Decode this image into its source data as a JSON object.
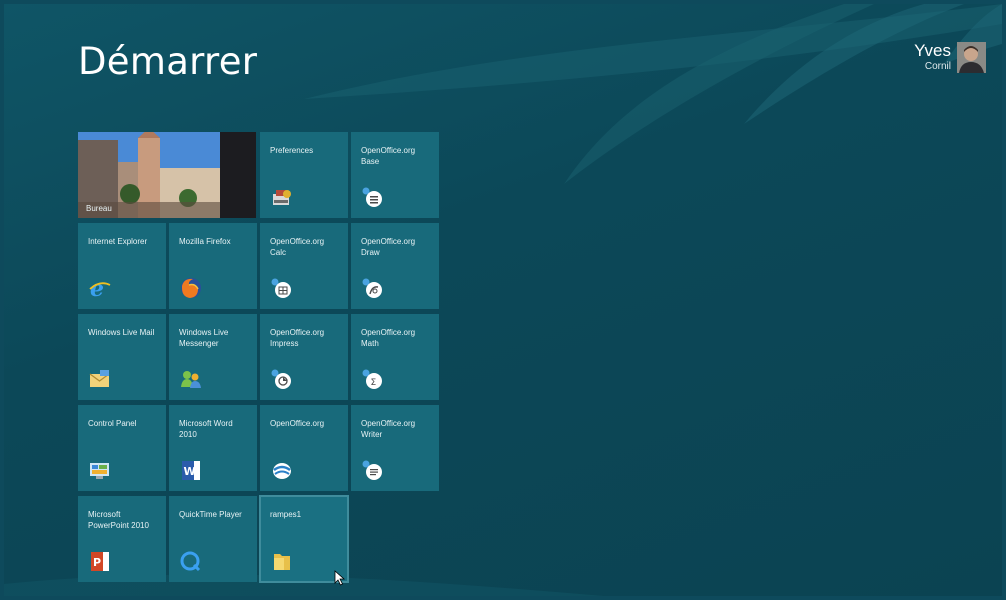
{
  "header": {
    "title": "Démarrer"
  },
  "user": {
    "name": "Yves",
    "surname": "Cornil"
  },
  "tiles": [
    {
      "label": "Bureau",
      "icon": "desktop-photo"
    },
    {
      "label": "Preferences",
      "icon": "preferences-icon"
    },
    {
      "label": "OpenOffice.org Base",
      "icon": "openoffice-base-icon"
    },
    {
      "label": "Internet Explorer",
      "icon": "internet-explorer-icon"
    },
    {
      "label": "Mozilla Firefox",
      "icon": "firefox-icon"
    },
    {
      "label": "OpenOffice.org Calc",
      "icon": "openoffice-calc-icon"
    },
    {
      "label": "OpenOffice.org Draw",
      "icon": "openoffice-draw-icon"
    },
    {
      "label": "Windows Live Mail",
      "icon": "mail-icon"
    },
    {
      "label": "Windows Live Messenger",
      "icon": "messenger-icon"
    },
    {
      "label": "OpenOffice.org Impress",
      "icon": "openoffice-impress-icon"
    },
    {
      "label": "OpenOffice.org Math",
      "icon": "openoffice-math-icon"
    },
    {
      "label": "Control Panel",
      "icon": "control-panel-icon"
    },
    {
      "label": "Microsoft Word 2010",
      "icon": "word-icon"
    },
    {
      "label": "OpenOffice.org",
      "icon": "openoffice-icon"
    },
    {
      "label": "OpenOffice.org Writer",
      "icon": "openoffice-writer-icon"
    },
    {
      "label": "Microsoft PowerPoint 2010",
      "icon": "powerpoint-icon"
    },
    {
      "label": "QuickTime Player",
      "icon": "quicktime-icon"
    },
    {
      "label": "rampes1",
      "icon": "folder-icon"
    }
  ],
  "colors": {
    "background": "#0e4a5c",
    "tile": "#186a7b"
  }
}
